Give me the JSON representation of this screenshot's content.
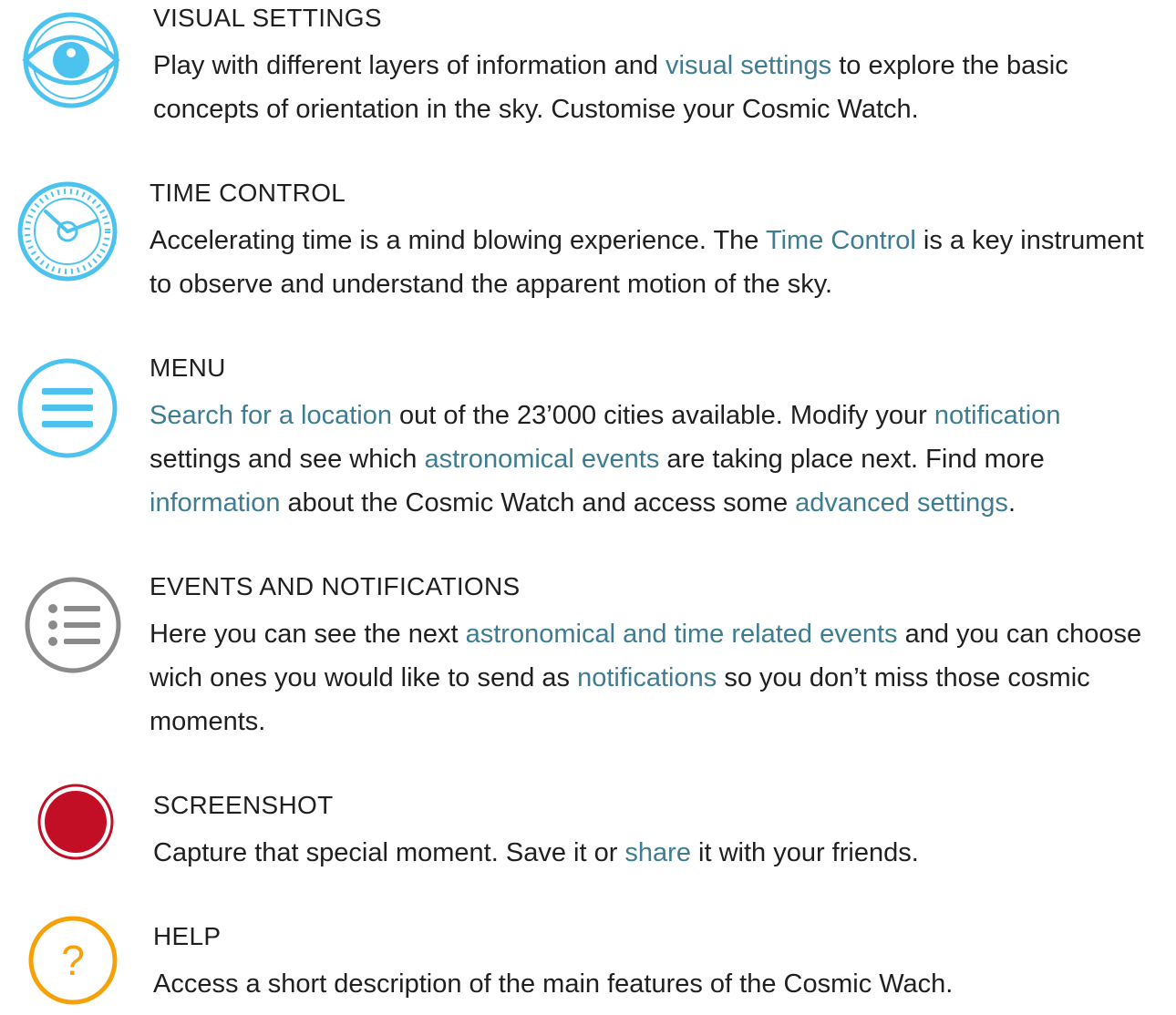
{
  "colors": {
    "link": "#3e7c8f",
    "text": "#1f1f1f",
    "cyan_icon": "#4cc3ee",
    "gray_icon": "#8a8a8a",
    "record_red": "#c20f25",
    "help_orange": "#f5a20a"
  },
  "sections": [
    {
      "icon": "eye-icon",
      "title": "VISUAL SETTINGS",
      "parts": [
        {
          "text": "Play with different layers of information and "
        },
        {
          "text": "visual settings",
          "link": true
        },
        {
          "text": " to explore the basic concepts of orientation in the sky. Customise your Cosmic Watch."
        }
      ]
    },
    {
      "icon": "clock-icon",
      "title": "TIME CONTROL",
      "parts": [
        {
          "text": "Accelerating time is a mind blowing experience. The "
        },
        {
          "text": "Time Control",
          "link": true
        },
        {
          "text": " is a key instrument to observe and understand the apparent motion of the sky."
        }
      ]
    },
    {
      "icon": "menu-icon",
      "title": "MENU",
      "parts": [
        {
          "text": "Search for a location",
          "link": true
        },
        {
          "text": " out of the 23’000 cities available. Modify your "
        },
        {
          "text": "notification",
          "link": true
        },
        {
          "text": " settings and see which "
        },
        {
          "text": "astronomical events",
          "link": true
        },
        {
          "text": " are taking place next. Find more "
        },
        {
          "text": "information",
          "link": true
        },
        {
          "text": " about the Cosmic Watch and access some "
        },
        {
          "text": "advanced settings",
          "link": true
        },
        {
          "text": "."
        }
      ]
    },
    {
      "icon": "list-icon",
      "title": "EVENTS AND NOTIFICATIONS",
      "parts": [
        {
          "text": "Here you can see the next "
        },
        {
          "text": "astronomical and time related events",
          "link": true
        },
        {
          "text": " and you can choose wich ones you would like to send as "
        },
        {
          "text": "notifications",
          "link": true
        },
        {
          "text": " so you don’t miss those cosmic moments."
        }
      ]
    },
    {
      "icon": "record-icon",
      "title": "SCREENSHOT",
      "parts": [
        {
          "text": "Capture that special moment. Save it or "
        },
        {
          "text": "share",
          "link": true
        },
        {
          "text": " it with your friends."
        }
      ]
    },
    {
      "icon": "help-icon",
      "title": "HELP",
      "help_glyph": "?",
      "parts": [
        {
          "text": "Access a short description of the main features of the Cosmic Wach."
        }
      ]
    }
  ]
}
